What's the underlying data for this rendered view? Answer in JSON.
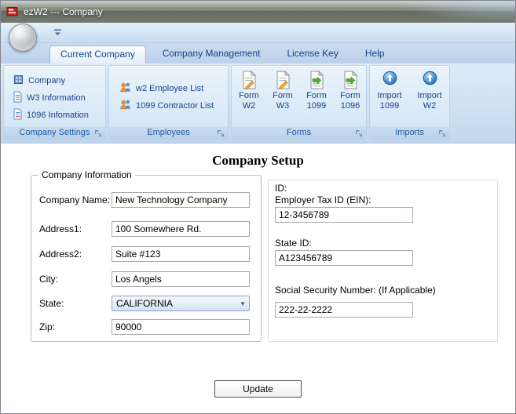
{
  "window": {
    "title": "ezW2 --- Company"
  },
  "theme": {
    "accent_text": "#15428b",
    "caption_text": "#1e5aa0",
    "ribbon_bg": "#cde1f3",
    "titlebar_bg": "#757a6f"
  },
  "ribbon": {
    "tabs": [
      {
        "label": "Current Company",
        "active": true
      },
      {
        "label": "Company Management",
        "active": false
      },
      {
        "label": "License Key",
        "active": false
      },
      {
        "label": "Help",
        "active": false
      }
    ],
    "groups": [
      {
        "caption": "Company Settings",
        "items": [
          "Company",
          "W3 Information",
          "1096 Infomation"
        ]
      },
      {
        "caption": "Employees",
        "items": [
          "w2 Employee List",
          "1099 Contractor List"
        ]
      },
      {
        "caption": "Forms",
        "items": [
          {
            "line1": "Form",
            "line2": "W2"
          },
          {
            "line1": "Form",
            "line2": "W3"
          },
          {
            "line1": "Form",
            "line2": "1099"
          },
          {
            "line1": "Form",
            "line2": "1096"
          }
        ]
      },
      {
        "caption": "Imports",
        "items": [
          {
            "line1": "Import",
            "line2": "1099"
          },
          {
            "line1": "Import",
            "line2": "W2"
          }
        ]
      }
    ]
  },
  "main": {
    "title": "Company Setup",
    "company_info": {
      "legend": "Company Information",
      "fields": [
        {
          "label": "Company Name:",
          "value": "New Technology Company"
        },
        {
          "label": "Address1:",
          "value": "100 Somewhere Rd."
        },
        {
          "label": "Address2:",
          "value": "Suite #123"
        },
        {
          "label": "City:",
          "value": "Los Angels"
        },
        {
          "label": "State:",
          "value": "CALIFORNIA"
        },
        {
          "label": "Zip:",
          "value": "90000"
        }
      ]
    },
    "ids": {
      "heading": "ID:",
      "fields": [
        {
          "label": "Employer Tax ID (EIN):",
          "value": "12-3456789"
        },
        {
          "label": "State ID:",
          "value": "A123456789"
        },
        {
          "label": "Social Security Number: (If Applicable)",
          "value": "222-22-2222"
        }
      ]
    },
    "update_button": "Update"
  }
}
